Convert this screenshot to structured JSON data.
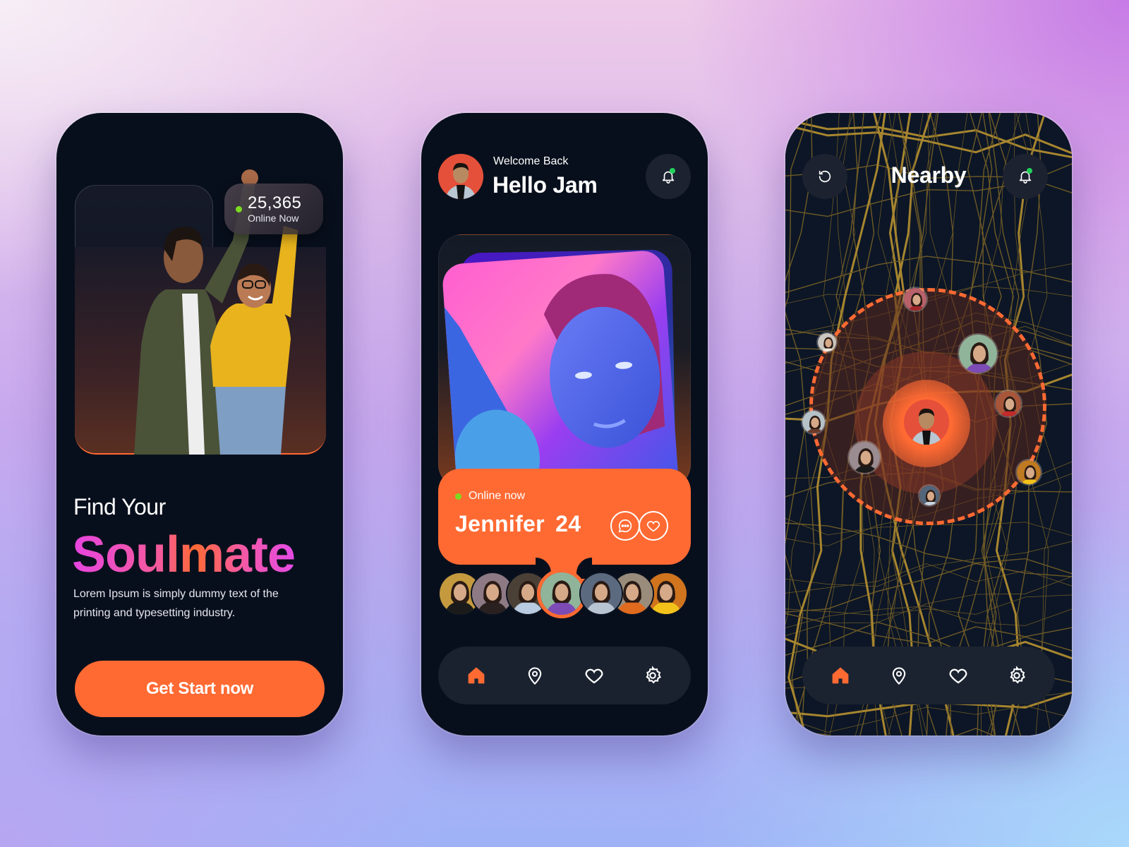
{
  "theme": {
    "accent": "#ff6a33",
    "phone_bg": "#080f1c",
    "nav_bg": "#1a2230",
    "online_dot": "#7bdc1f",
    "notification_dot": "#22d15a",
    "soulmate_gradient": [
      "#e645e0",
      "#ff6a33",
      "#e44ae6"
    ]
  },
  "onboarding": {
    "online_count": "25,365",
    "online_label": "Online Now",
    "headline_line1": "Find Your",
    "headline_line2": "Soulmate",
    "description": "Lorem Ipsum is simply dummy text of the printing and typesetting industry.",
    "cta_label": "Get Start now"
  },
  "home": {
    "greeting_small": "Welcome Back",
    "greeting_large": "Hello Jam",
    "featured_profile": {
      "status": "Online now",
      "name": "Jennifer",
      "age": "24"
    },
    "carousel": [
      {
        "name": "profile-1",
        "bg": "#c59a3e",
        "shirt": "#1a1a1a"
      },
      {
        "name": "profile-2",
        "bg": "#8d7a84",
        "shirt": "#2a2020"
      },
      {
        "name": "profile-3",
        "bg": "#4a4036",
        "shirt": "#b8cbe0"
      },
      {
        "name": "profile-4",
        "bg": "#8fb49a",
        "shirt": "#7d4bb5",
        "active": true
      },
      {
        "name": "profile-5",
        "bg": "#5c6a80",
        "shirt": "#b9c4d2"
      },
      {
        "name": "profile-6",
        "bg": "#9a8c7a",
        "shirt": "#e06a1e"
      },
      {
        "name": "profile-7",
        "bg": "#d0741e",
        "shirt": "#f2c21a"
      }
    ]
  },
  "nearby": {
    "title": "Nearby",
    "people": [
      {
        "name": "nearby-person-1",
        "bg": "#b8616a",
        "shirt": "#a3262a"
      },
      {
        "name": "nearby-person-2",
        "bg": "#cbc6bf",
        "shirt": "#efe7de"
      },
      {
        "name": "nearby-person-3",
        "bg": "#8fb49a",
        "shirt": "#7d4bb5"
      },
      {
        "name": "nearby-person-4",
        "bg": "#a8563a",
        "shirt": "#c22a2a"
      },
      {
        "name": "nearby-person-5",
        "bg": "#b6c2c8",
        "shirt": "#6a3a2a"
      },
      {
        "name": "nearby-person-6",
        "bg": "#9a8c90",
        "shirt": "#1a1a1a"
      },
      {
        "name": "nearby-person-7",
        "bg": "#52657a",
        "shirt": "#c9d4e0"
      },
      {
        "name": "nearby-person-8",
        "bg": "#c07a22",
        "shirt": "#f2c21a"
      }
    ]
  },
  "nav": {
    "items": [
      {
        "name": "home",
        "active": true
      },
      {
        "name": "location",
        "active": false
      },
      {
        "name": "favorites",
        "active": false
      },
      {
        "name": "settings",
        "active": false
      }
    ]
  }
}
